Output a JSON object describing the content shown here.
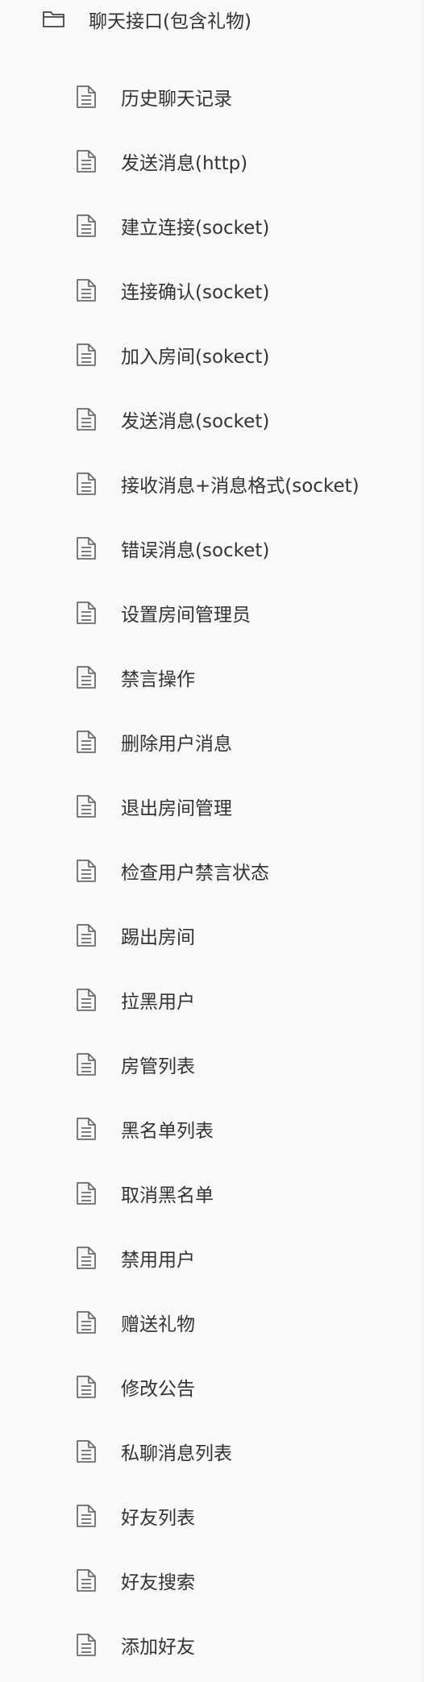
{
  "folder": {
    "label": "聊天接口(包含礼物)",
    "icon": "folder-open-icon"
  },
  "items": [
    {
      "label": "历史聊天记录",
      "icon": "document-icon"
    },
    {
      "label": "发送消息(http)",
      "icon": "document-icon"
    },
    {
      "label": "建立连接(socket)",
      "icon": "document-icon"
    },
    {
      "label": "连接确认(socket)",
      "icon": "document-icon"
    },
    {
      "label": "加入房间(sokect)",
      "icon": "document-icon"
    },
    {
      "label": "发送消息(socket)",
      "icon": "document-icon"
    },
    {
      "label": "接收消息+消息格式(socket)",
      "icon": "document-icon"
    },
    {
      "label": "错误消息(socket)",
      "icon": "document-icon"
    },
    {
      "label": "设置房间管理员",
      "icon": "document-icon"
    },
    {
      "label": "禁言操作",
      "icon": "document-icon"
    },
    {
      "label": "删除用户消息",
      "icon": "document-icon"
    },
    {
      "label": "退出房间管理",
      "icon": "document-icon"
    },
    {
      "label": "检查用户禁言状态",
      "icon": "document-icon"
    },
    {
      "label": "踢出房间",
      "icon": "document-icon"
    },
    {
      "label": "拉黑用户",
      "icon": "document-icon"
    },
    {
      "label": "房管列表",
      "icon": "document-icon"
    },
    {
      "label": "黑名单列表",
      "icon": "document-icon"
    },
    {
      "label": "取消黑名单",
      "icon": "document-icon"
    },
    {
      "label": "禁用用户",
      "icon": "document-icon"
    },
    {
      "label": "赠送礼物",
      "icon": "document-icon"
    },
    {
      "label": "修改公告",
      "icon": "document-icon"
    },
    {
      "label": "私聊消息列表",
      "icon": "document-icon"
    },
    {
      "label": "好友列表",
      "icon": "document-icon"
    },
    {
      "label": "好友搜索",
      "icon": "document-icon"
    },
    {
      "label": "添加好友",
      "icon": "document-icon"
    }
  ],
  "colors": {
    "background": "#f9f9f9",
    "text": "#333333",
    "icon": "#6b6b6b"
  }
}
